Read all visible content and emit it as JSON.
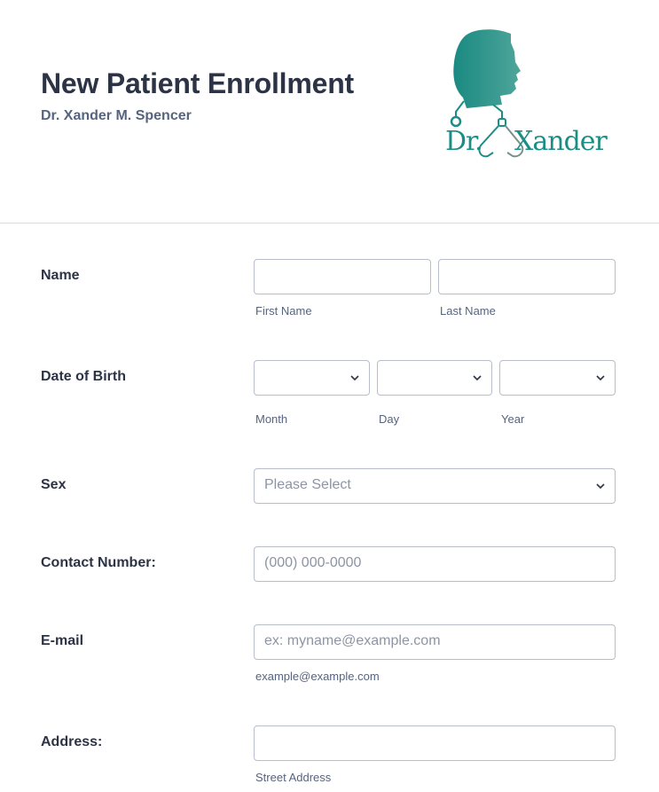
{
  "header": {
    "title": "New Patient Enrollment",
    "subtitle": "Dr. Xander M. Spencer",
    "logo_text": "Dr. Xander",
    "logo_dr": "Dr.",
    "logo_name": "Xander"
  },
  "colors": {
    "brand": "#1c8d85",
    "text": "#2c3345",
    "muted": "#57647e",
    "border": "#b8bdc9"
  },
  "form": {
    "name": {
      "label": "Name",
      "first_sublabel": "First Name",
      "last_sublabel": "Last Name",
      "first_value": "",
      "last_value": ""
    },
    "dob": {
      "label": "Date of Birth",
      "month_sublabel": "Month",
      "day_sublabel": "Day",
      "year_sublabel": "Year",
      "month_value": "",
      "day_value": "",
      "year_value": ""
    },
    "sex": {
      "label": "Sex",
      "placeholder": "Please Select"
    },
    "contact": {
      "label": "Contact Number:",
      "placeholder": "(000) 000-0000"
    },
    "email": {
      "label": "E-mail",
      "placeholder": "ex: myname@example.com",
      "sublabel": "example@example.com"
    },
    "address": {
      "label": "Address:",
      "street_sublabel": "Street Address",
      "street_value": ""
    }
  },
  "icons": {
    "dropdown": "chevron-down-icon",
    "logo": "doctor-head-stethoscope-icon"
  }
}
